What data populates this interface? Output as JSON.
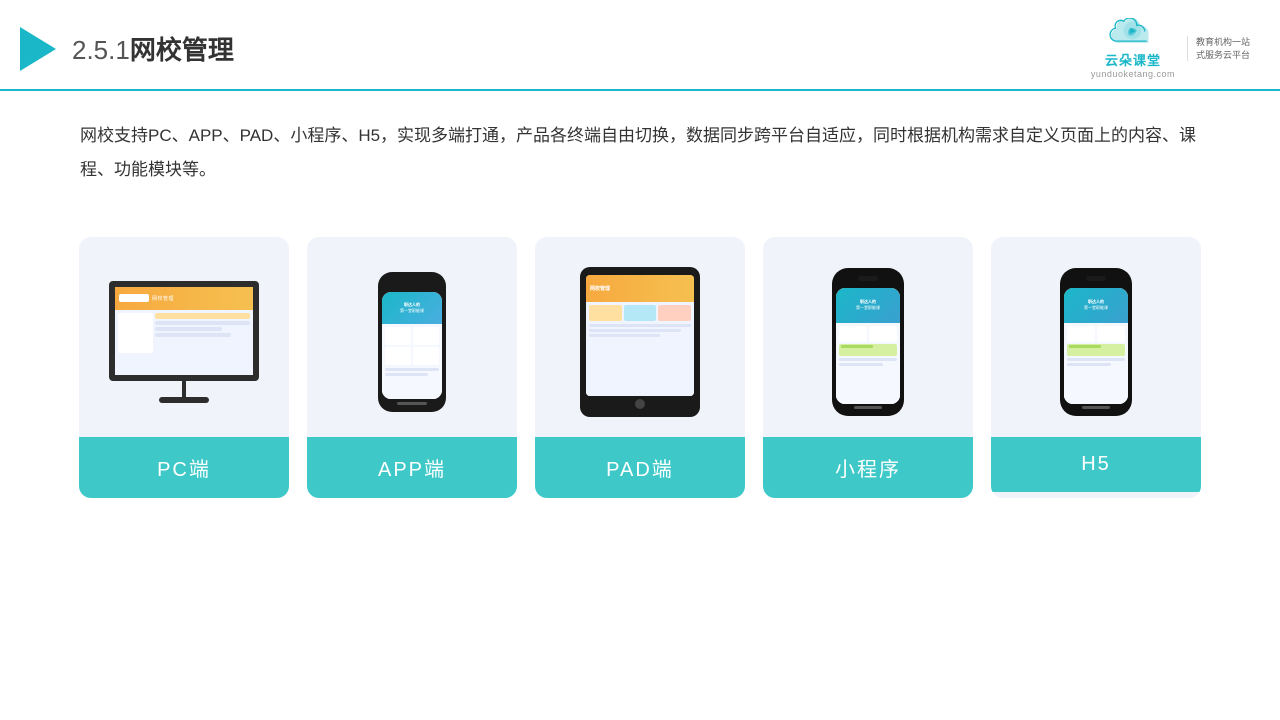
{
  "header": {
    "section": "2.5.1",
    "title": "网校管理",
    "logo_brand": "云朵课堂",
    "logo_url": "yunduoketang.com",
    "logo_tagline_line1": "教育机构一站",
    "logo_tagline_line2": "式服务云平台"
  },
  "description": {
    "text": "网校支持PC、APP、PAD、小程序、H5，实现多端打通，产品各终端自由切换，数据同步跨平台自适应，同时根据机构需求自定义页面上的内容、课程、功能模块等。"
  },
  "cards": [
    {
      "id": "pc",
      "label": "PC端"
    },
    {
      "id": "app",
      "label": "APP端"
    },
    {
      "id": "pad",
      "label": "PAD端"
    },
    {
      "id": "mini",
      "label": "小程序"
    },
    {
      "id": "h5",
      "label": "H5"
    }
  ],
  "colors": {
    "accent": "#1ab7c8",
    "card_label_bg": "#3ec8c8",
    "card_bg": "#f0f4fa",
    "header_border": "#1ab7c8"
  }
}
